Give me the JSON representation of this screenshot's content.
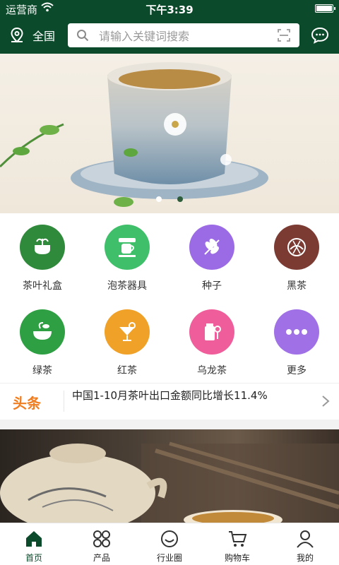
{
  "status_bar": {
    "carrier": "运营商",
    "time": "下午3:39"
  },
  "header": {
    "location_label": "全国",
    "search_placeholder": "请输入关键词搜索"
  },
  "banner": {
    "slide_count": 2,
    "active_slide": 0
  },
  "categories": [
    {
      "label": "茶叶礼盒",
      "color": "#2f8a3b"
    },
    {
      "label": "泡茶器具",
      "color": "#3fbf6a"
    },
    {
      "label": "种子",
      "color": "#9b6be6"
    },
    {
      "label": "黑茶",
      "color": "#7b3b33"
    },
    {
      "label": "绿茶",
      "color": "#2ea043"
    },
    {
      "label": "红茶",
      "color": "#f0a127"
    },
    {
      "label": "乌龙茶",
      "color": "#ef5e9a"
    },
    {
      "label": "更多",
      "color": "#9f70e6"
    }
  ],
  "news": {
    "tag": "头条",
    "headline": "中国1-10月茶叶出口金额同比增长11.4%"
  },
  "tabbar": {
    "items": [
      {
        "label": "首页",
        "icon": "home-icon",
        "active": true
      },
      {
        "label": "产品",
        "icon": "grid-icon",
        "active": false
      },
      {
        "label": "行业圈",
        "icon": "circle-icon",
        "active": false
      },
      {
        "label": "购物车",
        "icon": "cart-icon",
        "active": false
      },
      {
        "label": "我的",
        "icon": "user-icon",
        "active": false
      }
    ]
  },
  "colors": {
    "brand_green": "#0b4a2b",
    "news_orange": "#f07d1f"
  }
}
